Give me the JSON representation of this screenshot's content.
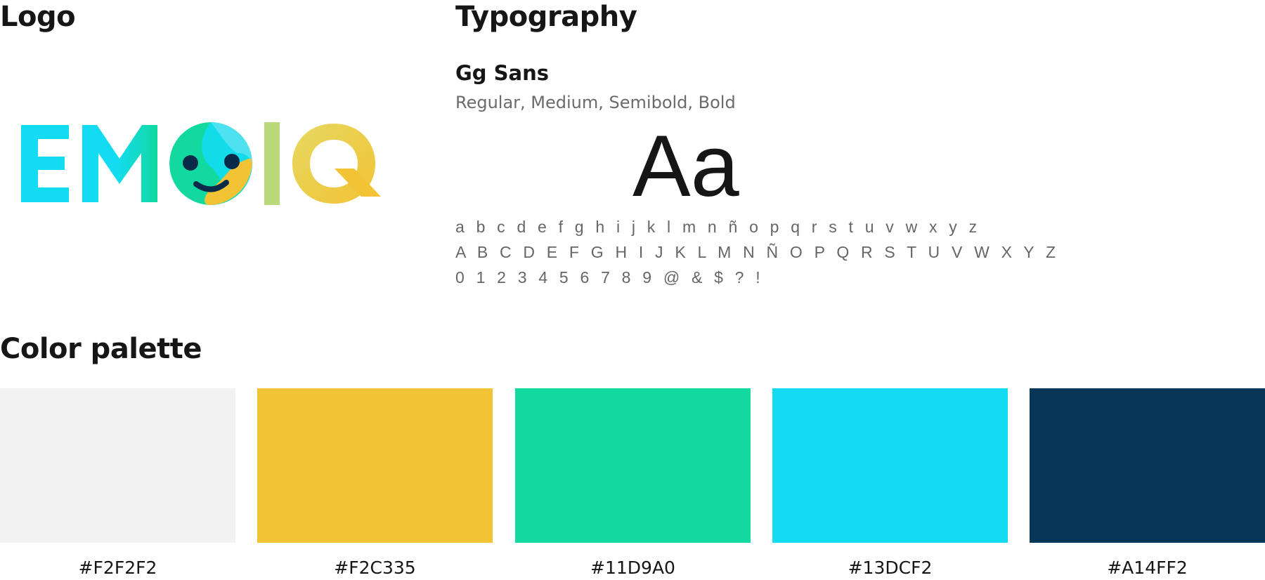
{
  "sections": {
    "logo": {
      "heading": "Logo"
    },
    "typography": {
      "heading": "Typography"
    },
    "palette": {
      "heading": "Color palette"
    }
  },
  "logo": {
    "wordmark": "EMOIQ",
    "colors": {
      "cyan": "#13DCF2",
      "teal": "#11D9A0",
      "yellow": "#F2C335",
      "lime": "#B9D97A",
      "navy": "#0A2A4A"
    }
  },
  "typography": {
    "font_name": "Gg Sans",
    "weights": "Regular, Medium, Semibold, Bold",
    "specimen": "Aa",
    "lowercase": "a b c d e f g h i j k l m n ñ o p q r s t u v w x y z",
    "uppercase": "A B C D E F G H I J K L M N Ñ O P Q R S T U V W X Y Z",
    "digits": "0 1 2 3 4 5 6 7 8 9 @ & $ ? !"
  },
  "palette": [
    {
      "hex": "#F2F2F2",
      "label": "#F2F2F2"
    },
    {
      "hex": "#F2C335",
      "label": "#F2C335"
    },
    {
      "hex": "#11D9A0",
      "label": "#11D9A0"
    },
    {
      "hex": "#13DCF2",
      "label": "#13DCF2"
    },
    {
      "hex": "#063759",
      "label": "#A14FF2"
    }
  ]
}
